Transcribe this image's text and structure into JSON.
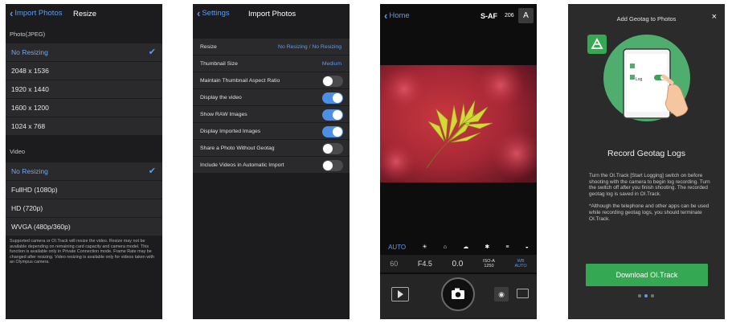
{
  "screen1": {
    "back_label": "Import Photos",
    "title": "Resize",
    "photo_section": "Photo(JPEG)",
    "photo_options": [
      "No Resizing",
      "2048 x 1536",
      "1920 x 1440",
      "1600 x 1200",
      "1024 x 768"
    ],
    "video_section": "Video",
    "video_options": [
      "No Resizing",
      "FullHD (1080p)",
      "HD (720p)",
      "WVGA (480p/360p)"
    ],
    "note": "Supported camera or OI.Track will resize the video. Resize may not be available depending on remaining card capacity and camera model. This function is available only in Private Connection mode. Frame Rate may be changed after resizing. Video resizing is available only for videos taken with an Olympus camera."
  },
  "screen2": {
    "back_label": "Settings",
    "title": "Import Photos",
    "rows": [
      {
        "label": "Resize",
        "value": "No Resizing / No Resizing"
      },
      {
        "label": "Thumbnail Size",
        "value": "Medium"
      },
      {
        "label": "Maintain Thumbnail Aspect Ratio",
        "toggle": "off"
      },
      {
        "label": "Display the video",
        "toggle": "on"
      },
      {
        "label": "Show RAW Images",
        "toggle": "on"
      },
      {
        "label": "Display Imported Images",
        "toggle": "on"
      },
      {
        "label": "Share a Photo Without Geotag",
        "toggle": "off"
      },
      {
        "label": "Include Videos in Automatic Import",
        "toggle": "off"
      }
    ]
  },
  "screen3": {
    "back_label": "Home",
    "focus_mode": "S-AF",
    "shots_remaining": "206",
    "mode": "A",
    "auto_label": "AUTO",
    "shutter": "60",
    "aperture": "F4.5",
    "exposure": "0.0",
    "iso_label": "ISO-A",
    "iso_value": "1250",
    "wb_label": "WB",
    "wb_value": "AUTO"
  },
  "screen4": {
    "dialog_title": "Add Geotag to Photos",
    "close_label": "×",
    "illustration_label": "Log",
    "heading": "Record Geotag Logs",
    "body1": "Turn the OI.Track [Start Logging] switch on before shooting with the camera to begin log recording. Turn the switch off after you finish shooting. The recorded geotag log is saved in OI.Track.",
    "body2": "*Although the telephone and other apps can be used while recording geotag logs, you should terminate OI.Track.",
    "button_label": "Download OI.Track",
    "page_count": 3,
    "active_page": 2
  }
}
